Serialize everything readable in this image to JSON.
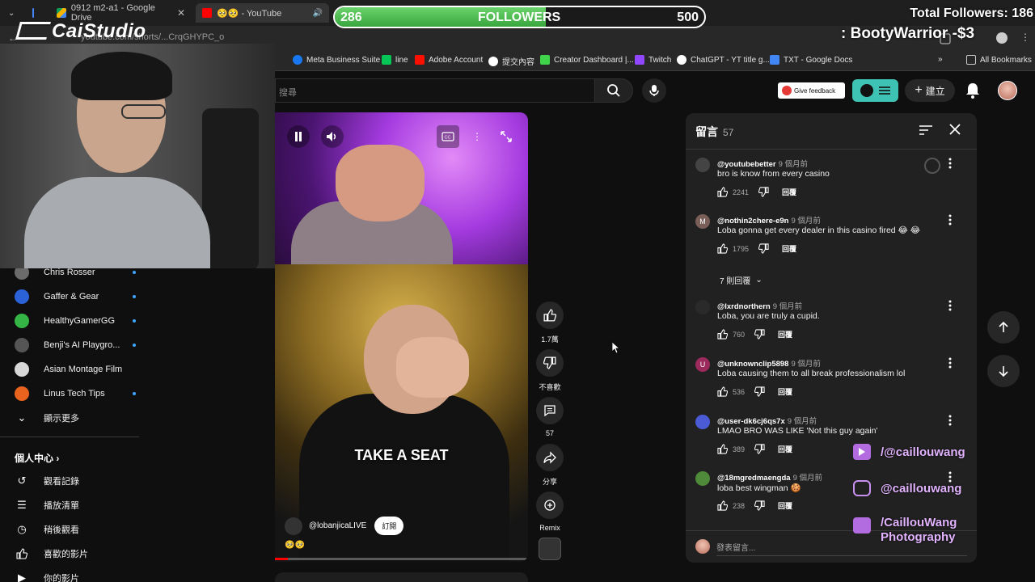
{
  "browser": {
    "tabs": [
      {
        "label": "0912 m2-a1 - Google Drive"
      },
      {
        "label": "🥺🥺 - YouTube"
      }
    ],
    "url": "youtube.com/shorts/...CrqGHYPC_o",
    "bookmarks": [
      "Meta Business Suite",
      "line",
      "Adobe Account",
      "提交內容",
      "Creator Dashboard |...",
      "Twitch",
      "ChatGPT - YT title g...",
      "TXT - Google Docs"
    ],
    "all_bookmarks": "All Bookmarks"
  },
  "overlay": {
    "followers_current": "286",
    "followers_label": "FOLLOWERS",
    "followers_goal": "500",
    "followers_progress": 0.572,
    "total_followers": "Total Followers: 186",
    "donation": ": BootyWarrior -$3",
    "logo": "CaiStudio",
    "socials": [
      {
        "handle": "/@caillouwang",
        "icon": "youtube-icon"
      },
      {
        "handle": "@caillouwang",
        "icon": "instagram-icon"
      },
      {
        "handle": "/CaillouWang",
        "handle2": "Photography",
        "icon": "facebook-icon"
      }
    ]
  },
  "sidebar": {
    "subscriptions": [
      {
        "label": "Chris Rosser",
        "color": "#6b6b6b"
      },
      {
        "label": "Gaffer & Gear",
        "color": "#2c62d8"
      },
      {
        "label": "HealthyGamerGG",
        "color": "#35b545"
      },
      {
        "label": "Benji's AI Playgro...",
        "color": "#555"
      },
      {
        "label": "Asian Montage Film",
        "color": "#d8d8d8"
      },
      {
        "label": "Linus Tech Tips",
        "color": "#e8641e"
      }
    ],
    "show_more": "顯示更多",
    "section_title": "個人中心",
    "personal": [
      {
        "label": "觀看記錄",
        "icon": "history-icon"
      },
      {
        "label": "播放清單",
        "icon": "playlist-icon"
      },
      {
        "label": "稍後觀看",
        "icon": "clock-icon"
      },
      {
        "label": "喜歡的影片",
        "icon": "thumb-up-icon"
      },
      {
        "label": "你的影片",
        "icon": "video-icon"
      }
    ]
  },
  "topbar": {
    "search_placeholder": "搜尋",
    "feedback": "Give feedback",
    "create": "建立"
  },
  "short": {
    "caption": "TAKE A SEAT",
    "channel": "@lobanjicaLIVE",
    "subscribe": "訂閱",
    "emoji": "🥺🥺",
    "progress": 0.05,
    "actions": {
      "likes": "1.7萬",
      "dislike": "不喜歡",
      "comments": "57",
      "share": "分享",
      "remix": "Remix"
    }
  },
  "comments": {
    "title": "留言",
    "count": "57",
    "replies_label": "7 則回覆",
    "reply_label": "回覆",
    "input_placeholder": "發表留言...",
    "items": [
      {
        "author": "@youtubebetter",
        "time": "9 個月前",
        "text": "bro is know from every casino",
        "likes": "2241",
        "avatar_color": "#444",
        "initial": ""
      },
      {
        "author": "@nothin2chere-e9n",
        "time": "9 個月前",
        "text": "Loba gonna get every dealer in this casino fired 😂 😂",
        "likes": "1795",
        "avatar_color": "#7a5e58",
        "initial": "M"
      },
      {
        "author": "@lxrdnorthern",
        "time": "9 個月前",
        "text": "Loba, you are truly a cupid.",
        "likes": "760",
        "avatar_color": "#2a2a2a",
        "initial": ""
      },
      {
        "author": "@unknownclip5898",
        "time": "9 個月前",
        "text": "Loba causing them to all break professionalism lol",
        "likes": "536",
        "avatar_color": "#9c2a5c",
        "initial": "U"
      },
      {
        "author": "@user-dk6cj6qs7x",
        "time": "9 個月前",
        "text": "LMAO BRO WAS LIKE 'Not this guy again'",
        "likes": "389",
        "avatar_color": "#4b5bd6",
        "initial": ""
      },
      {
        "author": "@18mgredmaengda",
        "time": "9 個月前",
        "text": "loba best wingman 🍪",
        "likes": "238",
        "avatar_color": "#4e8a3a",
        "initial": ""
      }
    ]
  }
}
